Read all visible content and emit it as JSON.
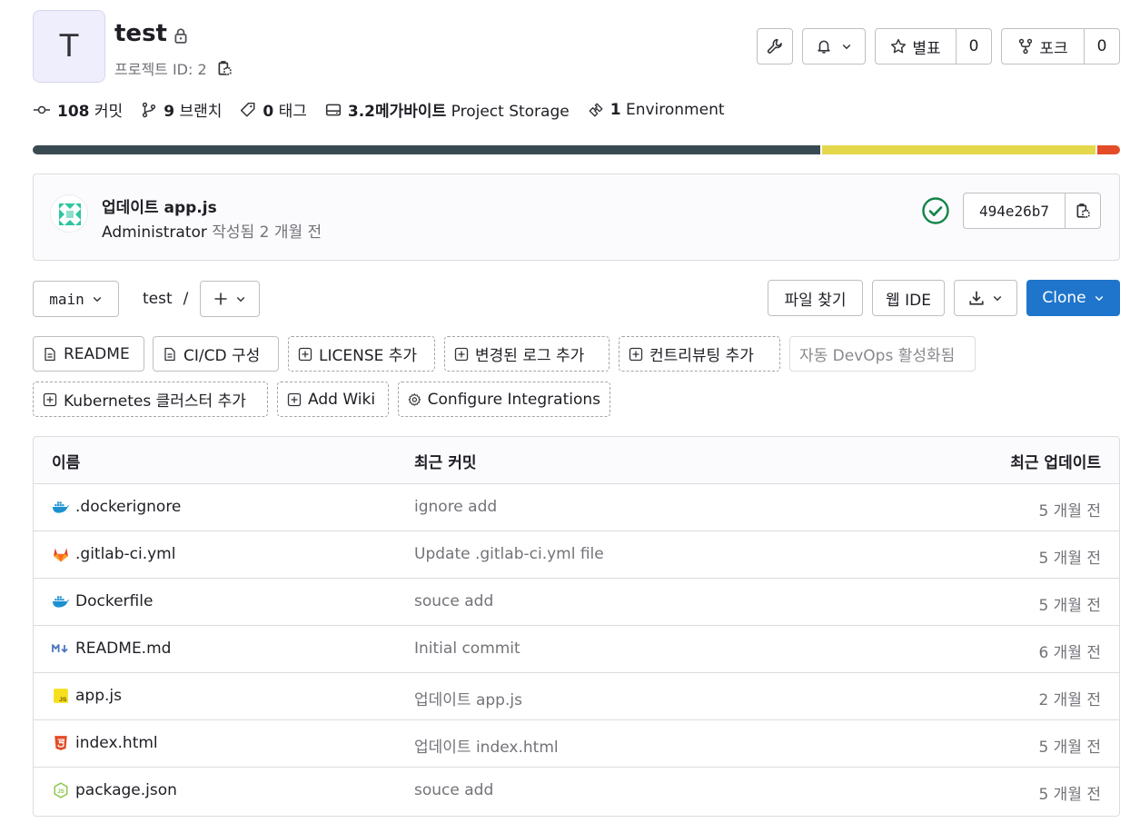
{
  "project": {
    "avatar_letter": "T",
    "name": "test",
    "id_label": "프로젝트 ID: 2"
  },
  "header_buttons": {
    "star_label": "별표",
    "star_count": "0",
    "fork_label": "포크",
    "fork_count": "0"
  },
  "stats": [
    {
      "icon": "commit-icon",
      "value": "108",
      "label": "커밋"
    },
    {
      "icon": "branch-icon",
      "value": "9",
      "label": "브랜치"
    },
    {
      "icon": "tag-icon",
      "value": "0",
      "label": "태그"
    },
    {
      "icon": "storage-icon",
      "value": "3.2메가바이트",
      "label": "Project Storage"
    },
    {
      "icon": "environment-icon",
      "value": "1",
      "label": "Environment"
    }
  ],
  "languages": [
    {
      "color": "#3a4a52",
      "percent": 72.7
    },
    {
      "color": "#e5d74c",
      "percent": 25.2
    },
    {
      "color": "#e34c26",
      "percent": 2.1
    }
  ],
  "last_commit": {
    "title": "업데이트 app.js",
    "author": "Administrator",
    "meta": "작성됨 2 개월 전",
    "sha": "494e26b7"
  },
  "repo_toolbar": {
    "branch": "main",
    "path_root": "test",
    "path_sep": "/",
    "find_file": "파일 찾기",
    "web_ide": "웹 IDE",
    "clone": "Clone"
  },
  "shortcuts": {
    "readme": "README",
    "cicd": "CI/CD 구성",
    "license": "LICENSE 추가",
    "changelog": "변경된 로그 추가",
    "contributing": "컨트리뷰팅 추가",
    "autodevops": "자동 DevOps 활성화됨",
    "kubernetes": "Kubernetes 클러스터 추가",
    "wiki": "Add Wiki",
    "integrations": "Configure Integrations"
  },
  "table": {
    "headers": {
      "name": "이름",
      "last_commit": "최근 커밋",
      "last_update": "최근 업데이트"
    },
    "rows": [
      {
        "icon": "docker-icon",
        "name": ".dockerignore",
        "message": "ignore add",
        "updated": "5 개월 전"
      },
      {
        "icon": "gitlab-icon",
        "name": ".gitlab-ci.yml",
        "message": "Update .gitlab-ci.yml file",
        "updated": "5 개월 전"
      },
      {
        "icon": "docker-icon",
        "name": "Dockerfile",
        "message": "souce add",
        "updated": "5 개월 전"
      },
      {
        "icon": "markdown-icon",
        "name": "README.md",
        "message": "Initial commit",
        "updated": "6 개월 전"
      },
      {
        "icon": "javascript-icon",
        "name": "app.js",
        "message": "업데이트 app.js",
        "updated": "2 개월 전"
      },
      {
        "icon": "html-icon",
        "name": "index.html",
        "message": "업데이트 index.html",
        "updated": "5 개월 전"
      },
      {
        "icon": "nodejs-icon",
        "name": "package.json",
        "message": "souce add",
        "updated": "5 개월 전"
      }
    ]
  }
}
